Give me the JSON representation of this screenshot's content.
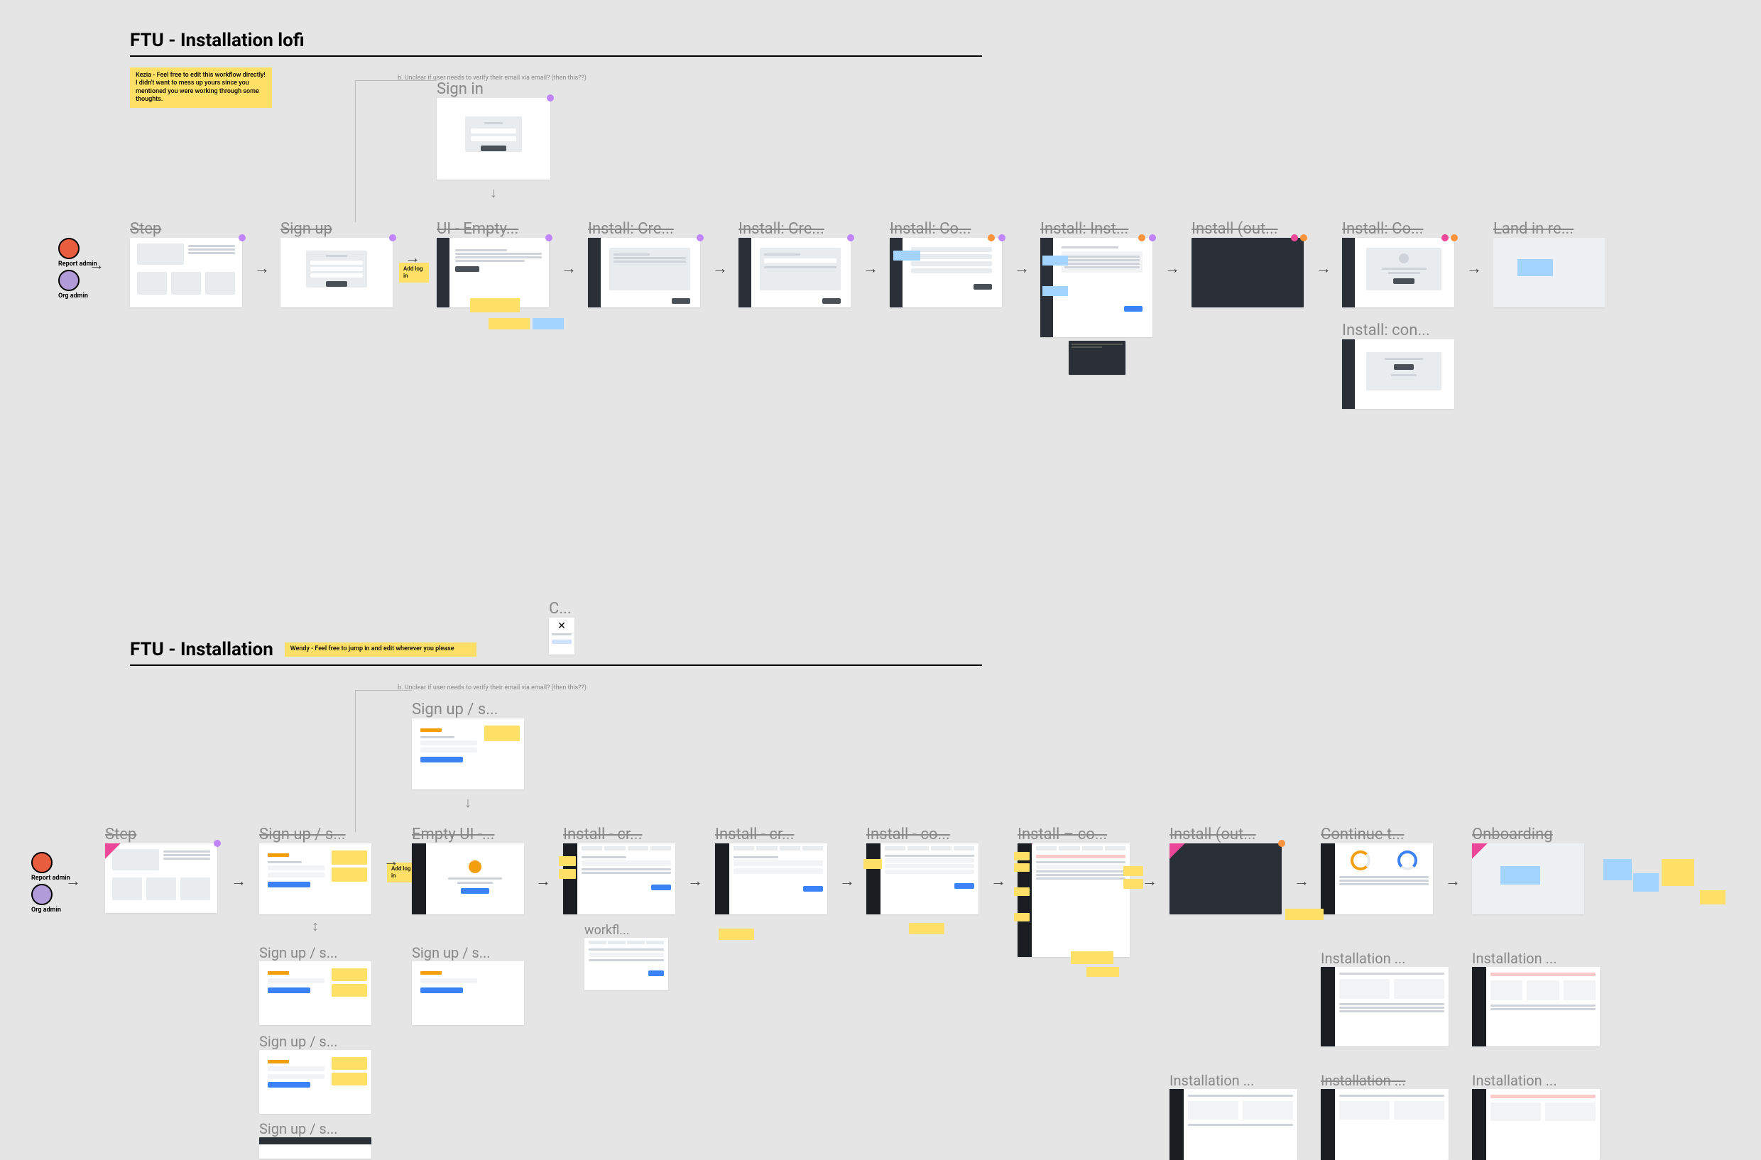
{
  "section1": {
    "title": "FTU - Installation lofi",
    "sticky_kezia": "Kezia - Feel free to edit this workflow directly!\nI didn't want to mess up yours since you mentioned you were working through some thoughts.",
    "avatars": {
      "report_admin": "Report admin",
      "org_admin": "Org admin"
    },
    "branch_note": "b. Unclear if user needs to verify their email via email? (then this??)",
    "signin_label": "Sign in",
    "add_login_note": "Add log in",
    "frames": [
      "Step",
      "Sign up",
      "UI - Empty...",
      "Install: Cre...",
      "Install: Cre...",
      "Install: Co...",
      "Install: Inst...",
      "Install (out...",
      "Install: Co...",
      "Land in re..."
    ],
    "alt_frame": "Install: con..."
  },
  "section2": {
    "title": "FTU - Installation",
    "sticky_wendy": "Wendy - Feel free to jump in and edit wherever you please",
    "top_label": "C...",
    "avatars": {
      "report_admin": "Report admin",
      "org_admin": "Org admin"
    },
    "branch_note": "b. Unclear if user needs to verify their email via email? (then this??)",
    "signup_branch_label": "Sign up / s...",
    "add_login_note": "Add log in",
    "workflow_label": "workfl...",
    "frames": [
      "Step",
      "Sign up / s...",
      "Empty UI -...",
      "Install - cr...",
      "Install - cr...",
      "Install - co...",
      "Install – co...",
      "Install (out...",
      "Continue t...",
      "Onboarding"
    ],
    "signup_variants": [
      "Sign up / s...",
      "Sign up / s...",
      "Sign up / s..."
    ],
    "signup_extra": "Sign up / s...",
    "install_variants": [
      "Installation ...",
      "Installation ...",
      "Installation ...",
      "Installation ...",
      "Installation ..."
    ]
  }
}
